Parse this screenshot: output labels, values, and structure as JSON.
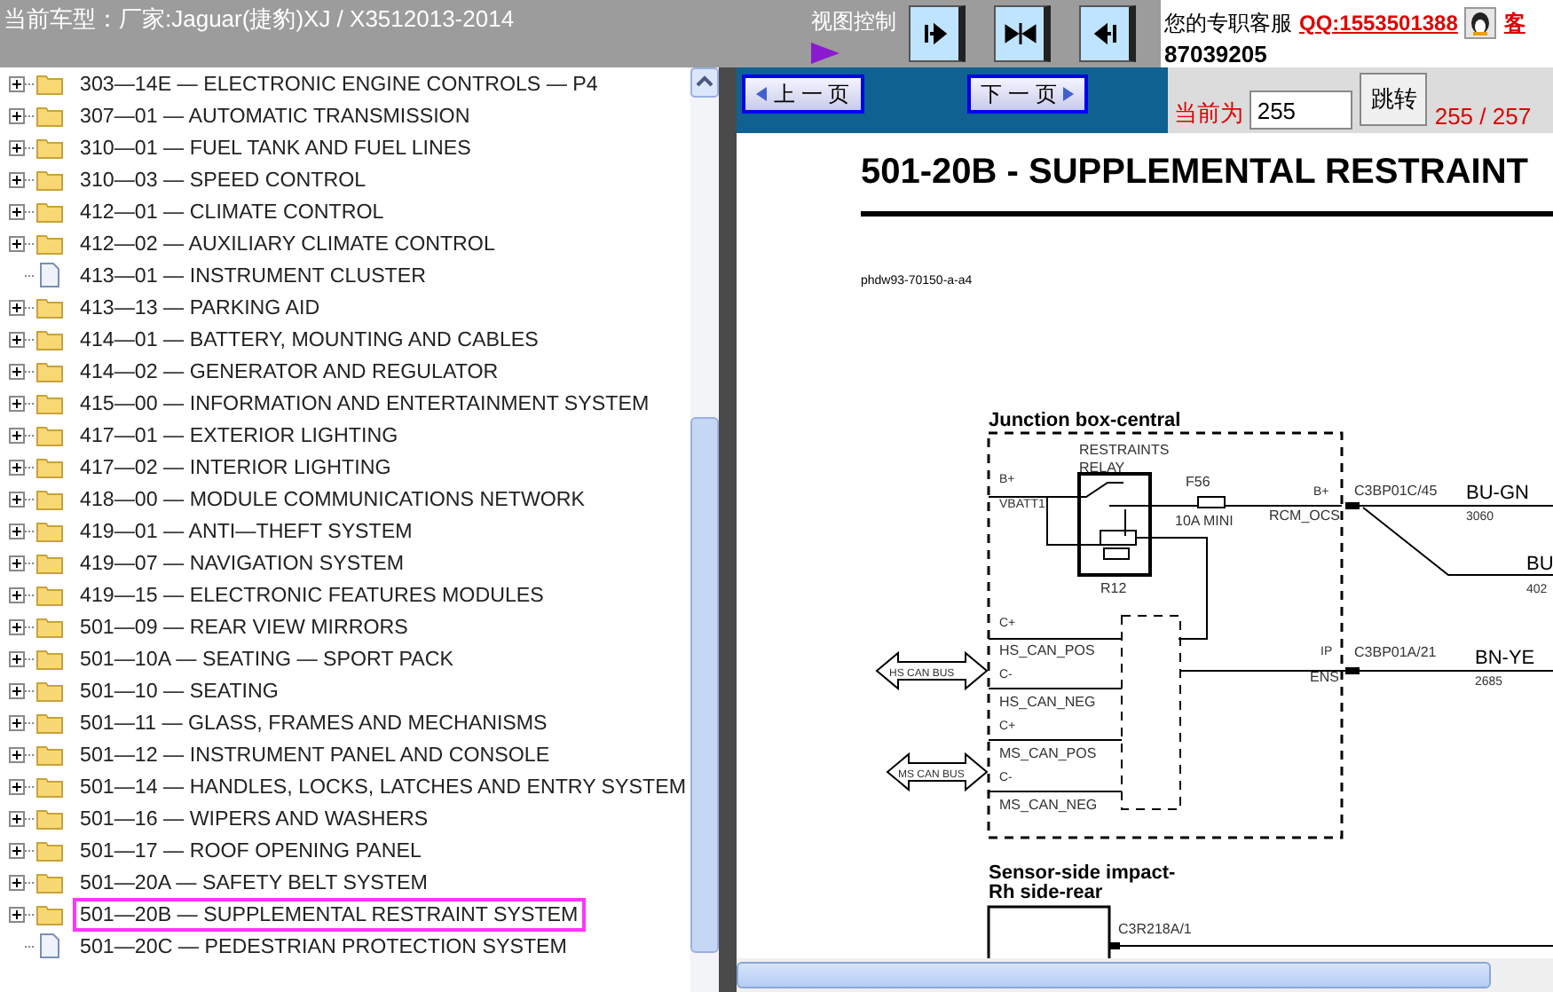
{
  "header": {
    "vehicle": "当前车型：厂家:Jaguar(捷豹)XJ / X3512013-2014",
    "view_control": "视图控制"
  },
  "support": {
    "label": "您的专职客服",
    "qq": "QQ:1553501388",
    "extra": "客",
    "phone": "87039205"
  },
  "tree": {
    "items": [
      {
        "label": "303—14E — ELECTRONIC ENGINE CONTROLS — P4",
        "kind": "folder",
        "selected": false
      },
      {
        "label": "307—01 — AUTOMATIC TRANSMISSION",
        "kind": "folder",
        "selected": false
      },
      {
        "label": "310—01 — FUEL TANK AND FUEL LINES",
        "kind": "folder",
        "selected": false
      },
      {
        "label": "310—03 — SPEED CONTROL",
        "kind": "folder",
        "selected": false
      },
      {
        "label": "412—01 — CLIMATE CONTROL",
        "kind": "folder",
        "selected": false
      },
      {
        "label": "412—02 — AUXILIARY CLIMATE CONTROL",
        "kind": "folder",
        "selected": false
      },
      {
        "label": "413—01 — INSTRUMENT CLUSTER",
        "kind": "file",
        "selected": false
      },
      {
        "label": "413—13 — PARKING AID",
        "kind": "folder",
        "selected": false
      },
      {
        "label": "414—01 — BATTERY, MOUNTING AND CABLES",
        "kind": "folder",
        "selected": false
      },
      {
        "label": "414—02 — GENERATOR AND REGULATOR",
        "kind": "folder",
        "selected": false
      },
      {
        "label": "415—00 — INFORMATION AND ENTERTAINMENT SYSTEM",
        "kind": "folder",
        "selected": false
      },
      {
        "label": "417—01 — EXTERIOR LIGHTING",
        "kind": "folder",
        "selected": false
      },
      {
        "label": "417—02 — INTERIOR LIGHTING",
        "kind": "folder",
        "selected": false
      },
      {
        "label": "418—00 — MODULE COMMUNICATIONS NETWORK",
        "kind": "folder",
        "selected": false
      },
      {
        "label": "419—01 — ANTI—THEFT SYSTEM",
        "kind": "folder",
        "selected": false
      },
      {
        "label": "419—07 — NAVIGATION SYSTEM",
        "kind": "folder",
        "selected": false
      },
      {
        "label": "419—15 — ELECTRONIC FEATURES MODULES",
        "kind": "folder",
        "selected": false
      },
      {
        "label": "501—09 — REAR VIEW MIRRORS",
        "kind": "folder",
        "selected": false
      },
      {
        "label": "501—10A — SEATING — SPORT PACK",
        "kind": "folder",
        "selected": false
      },
      {
        "label": "501—10 — SEATING",
        "kind": "folder",
        "selected": false
      },
      {
        "label": "501—11 — GLASS, FRAMES AND MECHANISMS",
        "kind": "folder",
        "selected": false
      },
      {
        "label": "501—12 — INSTRUMENT PANEL AND CONSOLE",
        "kind": "folder",
        "selected": false
      },
      {
        "label": "501—14 — HANDLES, LOCKS, LATCHES AND ENTRY SYSTEM",
        "kind": "folder",
        "selected": false
      },
      {
        "label": "501—16 — WIPERS AND WASHERS",
        "kind": "folder",
        "selected": false
      },
      {
        "label": "501—17 — ROOF OPENING PANEL",
        "kind": "folder",
        "selected": false
      },
      {
        "label": "501—20A — SAFETY BELT SYSTEM",
        "kind": "folder",
        "selected": false
      },
      {
        "label": "501—20B — SUPPLEMENTAL RESTRAINT SYSTEM",
        "kind": "folder",
        "selected": true
      },
      {
        "label": "501—20C — PEDESTRIAN PROTECTION SYSTEM",
        "kind": "file",
        "selected": false
      }
    ]
  },
  "pager": {
    "prev": "上 一 页",
    "next": "下 一 页",
    "current_label": "当前为",
    "page_value": "255",
    "go": "跳转",
    "page_count": "255 / 257"
  },
  "document": {
    "title": "501-20B - SUPPLEMENTAL RESTRAINT",
    "code": "phdw93-70150-a-a4",
    "diagram": {
      "labels": [
        "Junction box-central",
        "RESTRAINTS",
        "RELAY",
        "R12",
        "B+",
        "VBATT1",
        "F56",
        "10A MINI",
        "B+",
        "RCM_OCS",
        "C3BP01C/45",
        "BU-GN",
        "3060",
        "BU",
        "402",
        "C+",
        "HS_CAN_POS",
        "C-",
        "HS_CAN_NEG",
        "C+",
        "MS_CAN_POS",
        "C-",
        "MS_CAN_NEG",
        "HS CAN BUS",
        "MS CAN BUS",
        "IP",
        "ENS",
        "C3BP01A/21",
        "BN-YE",
        "2685",
        "Sensor-side impact-",
        "Rh side-rear",
        "C3R218A/1"
      ]
    }
  }
}
